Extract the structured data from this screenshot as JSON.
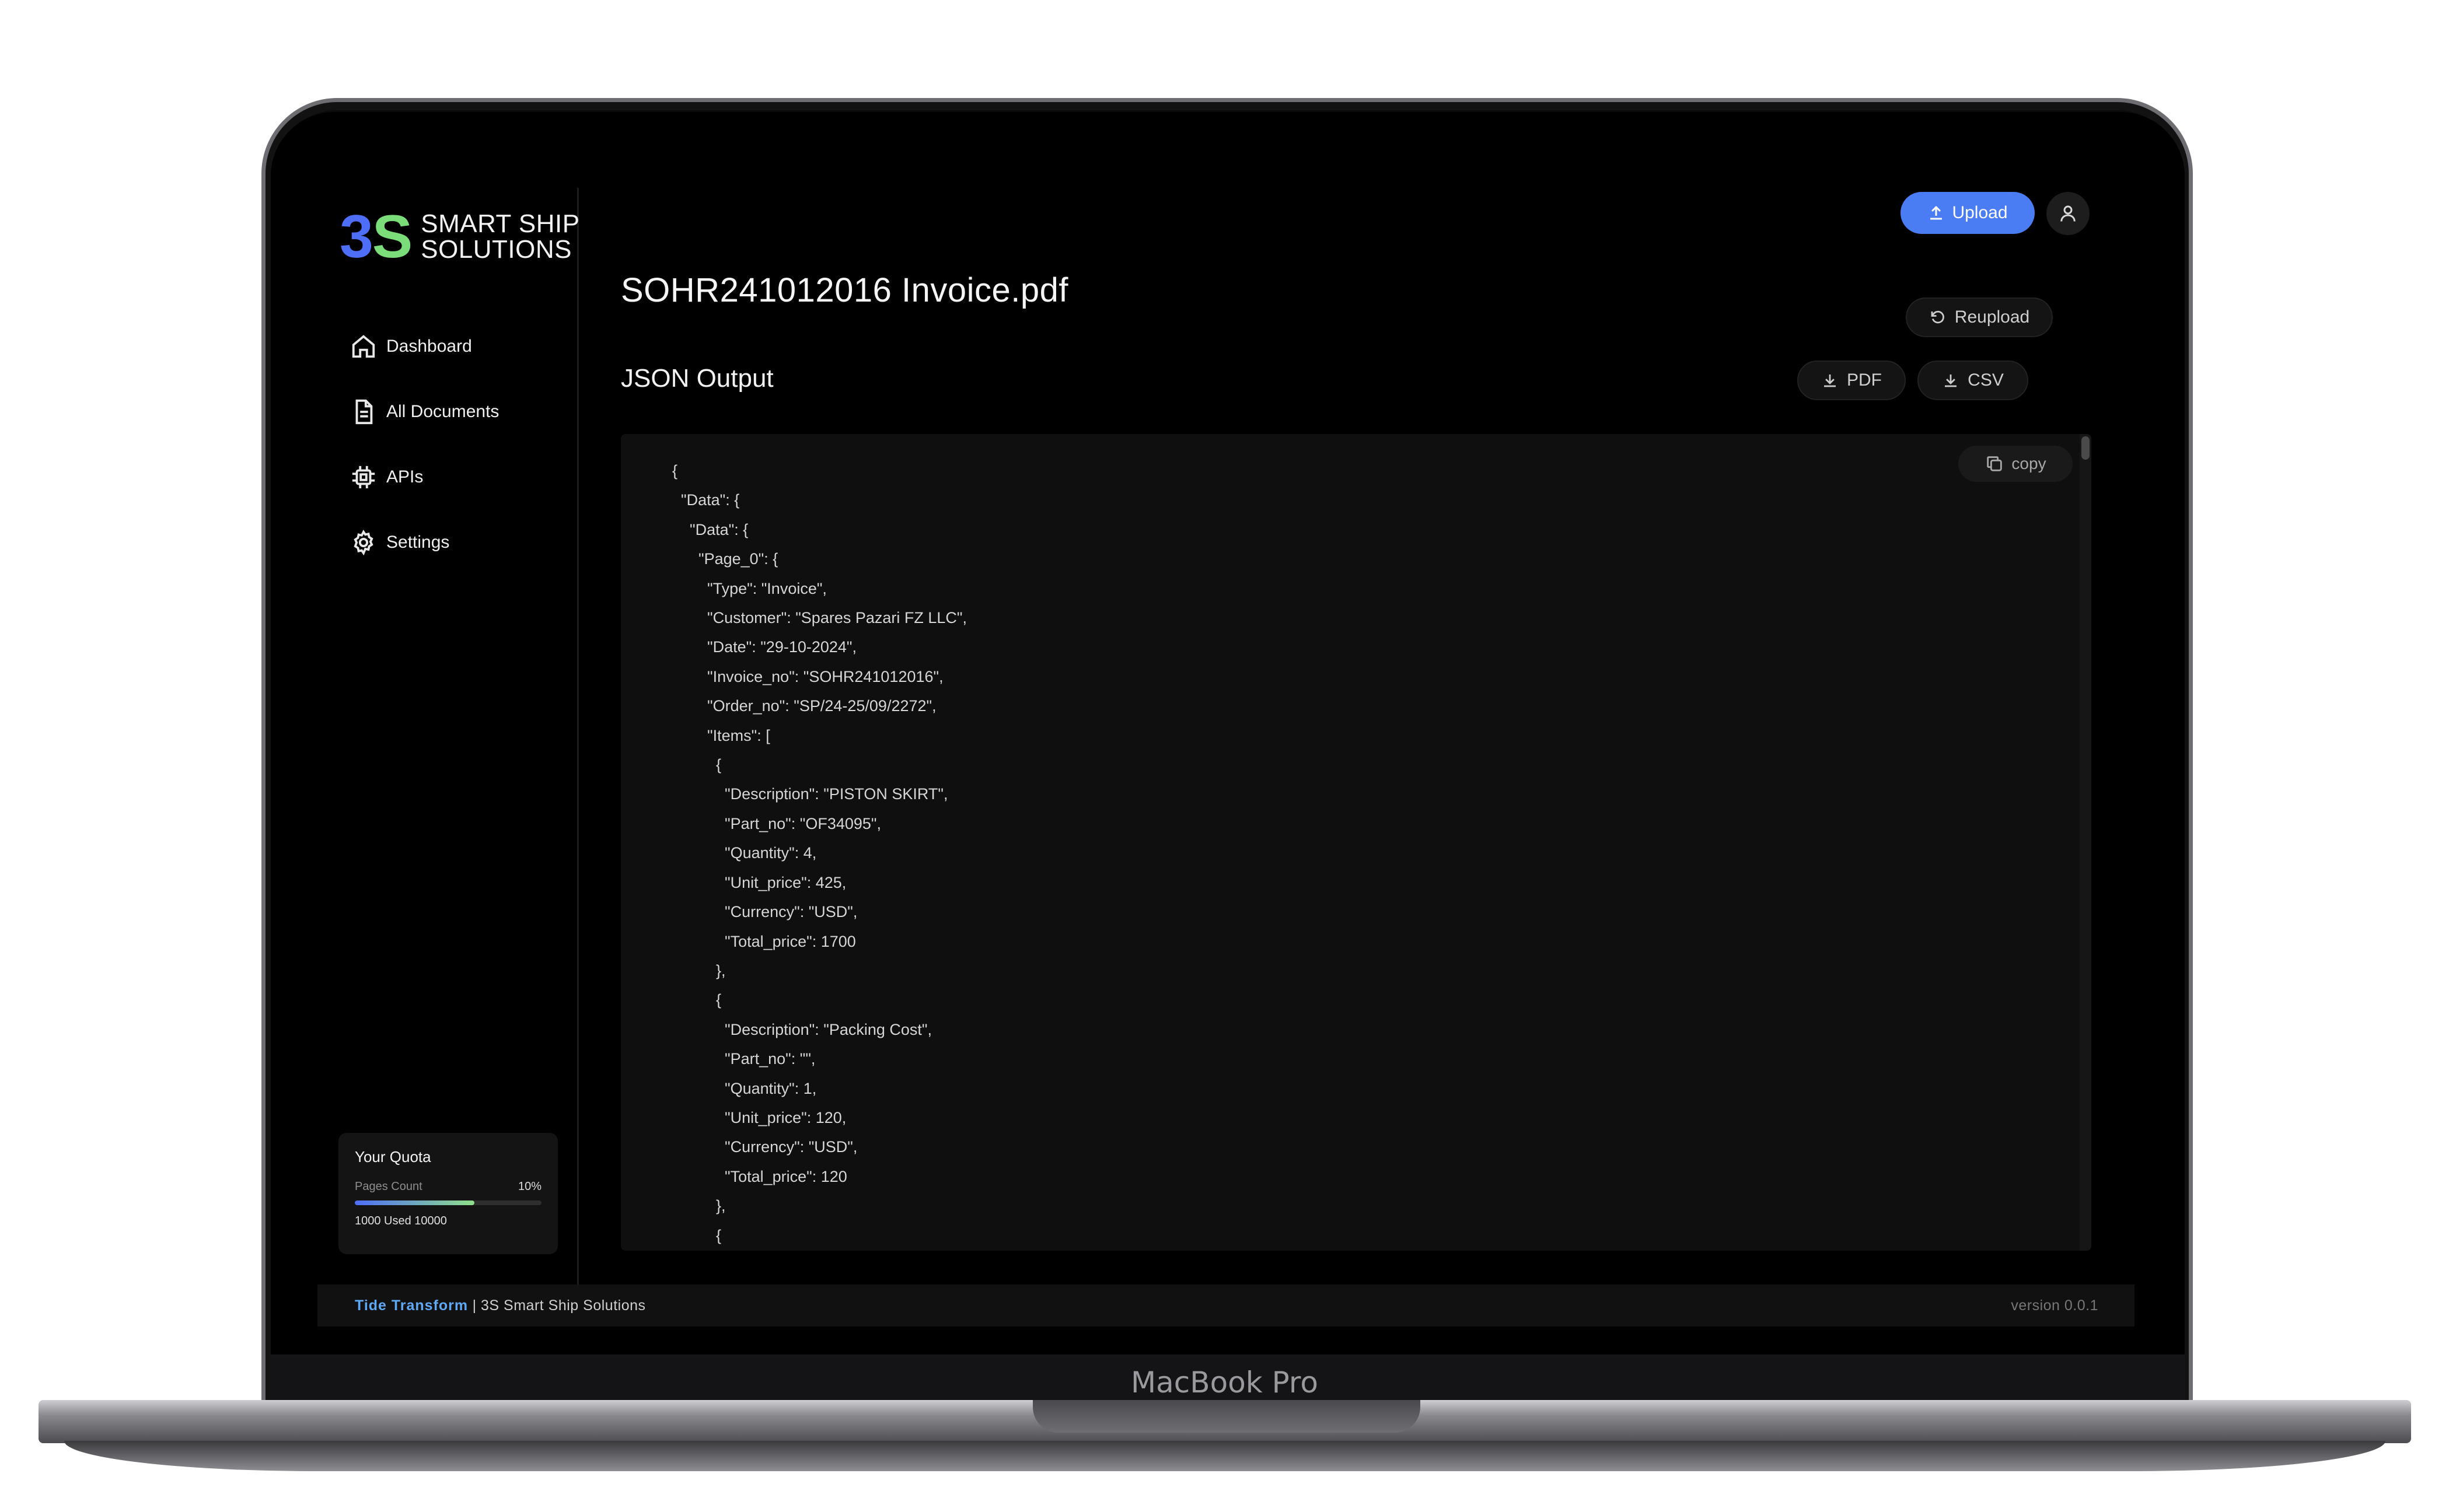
{
  "device": {
    "label": "MacBook Pro"
  },
  "sidebar": {
    "logo": {
      "mark_3": "3",
      "mark_s": "S",
      "line1": "SMART SHIP",
      "line2": "SOLUTIONS"
    },
    "items": [
      {
        "label": "Dashboard",
        "icon": "home-icon"
      },
      {
        "label": "All Documents",
        "icon": "document-icon"
      },
      {
        "label": "APIs",
        "icon": "chip-icon"
      },
      {
        "label": "Settings",
        "icon": "gear-icon"
      }
    ],
    "quota": {
      "title": "Your Quota",
      "metric_label": "Pages Count",
      "percent_label": "10%",
      "percent": 0.64,
      "usage_text": "1000 Used 10000"
    }
  },
  "header": {
    "upload_label": "Upload"
  },
  "document": {
    "title": "SOHR241012016 Invoice.pdf",
    "reupload_label": "Reupload",
    "section_title": "JSON Output",
    "download_pdf_label": "PDF",
    "download_csv_label": "CSV",
    "copy_label": "copy",
    "json_lines": [
      "{",
      "  \"Data\": {",
      "    \"Data\": {",
      "      \"Page_0\": {",
      "        \"Type\": \"Invoice\",",
      "        \"Customer\": \"Spares Pazari FZ LLC\",",
      "        \"Date\": \"29-10-2024\",",
      "        \"Invoice_no\": \"SOHR241012016\",",
      "        \"Order_no\": \"SP/24-25/09/2272\",",
      "        \"Items\": [",
      "          {",
      "            \"Description\": \"PISTON SKIRT\",",
      "            \"Part_no\": \"OF34095\",",
      "            \"Quantity\": 4,",
      "            \"Unit_price\": 425,",
      "            \"Currency\": \"USD\",",
      "            \"Total_price\": 1700",
      "          },",
      "          {",
      "            \"Description\": \"Packing Cost\",",
      "            \"Part_no\": \"\",",
      "            \"Quantity\": 1,",
      "            \"Unit_price\": 120,",
      "            \"Currency\": \"USD\",",
      "            \"Total_price\": 120",
      "          },",
      "          {"
    ]
  },
  "footer": {
    "brand": "Tide Transform",
    "separator": " | ",
    "company": "3S Smart Ship Solutions",
    "version": "version 0.0.1"
  }
}
